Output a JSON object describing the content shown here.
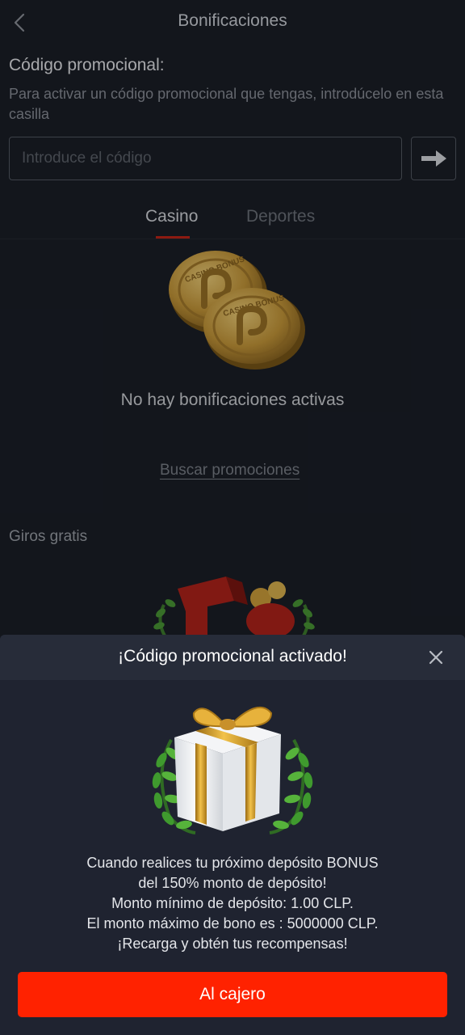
{
  "header": {
    "title": "Bonificaciones",
    "back_icon": "chevron-left-icon"
  },
  "promo": {
    "title": "Código promocional:",
    "description": "Para activar un código promocional que tengas, introdúcelo en esta casilla",
    "input_value": "",
    "input_placeholder": "Introduce el código",
    "submit_icon": "arrow-right-icon"
  },
  "tabs": [
    {
      "label": "Casino",
      "active": true
    },
    {
      "label": "Deportes",
      "active": false
    }
  ],
  "bonuses": {
    "coin_text": "CASINO BONUS",
    "empty_text": "No hay bonificaciones activas",
    "search_link": "Buscar promociones"
  },
  "free_spins": {
    "title": "Giros gratis"
  },
  "modal": {
    "title": "¡Código promocional activado!",
    "close_icon": "close-icon",
    "gift_icon": "gift-icon",
    "message_lines": [
      "Cuando realices tu próximo depósito BONUS",
      "del 150% monto de depósito!",
      "Monto mínimo de depósito: 1.00 CLP.",
      "El monto máximo de bono es : 5000000 CLP.",
      "¡Recarga y obtén tus recompensas!"
    ],
    "cta_label": "Al cajero"
  },
  "colors": {
    "background": "#1b1f28",
    "sheet": "#1f2330",
    "accent": "#ff2200",
    "tab_indicator": "#c42418"
  }
}
